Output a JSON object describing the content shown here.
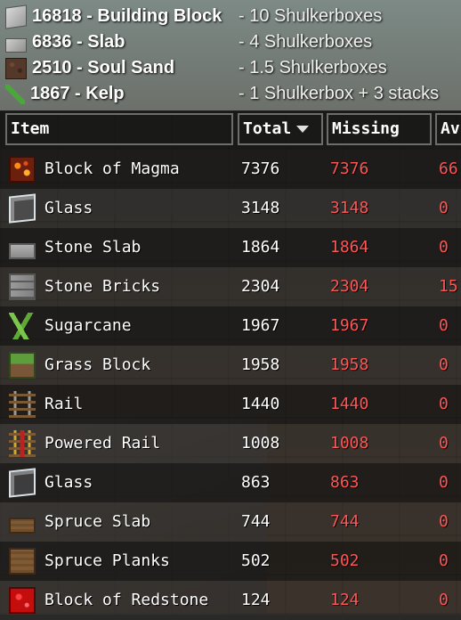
{
  "summary": [
    {
      "icon": "building-block-icon",
      "text": "16818 - Building Block",
      "note": "- 10 Shulkerboxes"
    },
    {
      "icon": "slab-icon",
      "text": "6836 - Slab",
      "note": "- 4 Shulkerboxes"
    },
    {
      "icon": "soul-sand-icon",
      "text": "2510 - Soul Sand",
      "note": "- 1.5 Shulkerboxes"
    },
    {
      "icon": "kelp-icon",
      "text": "1867 - Kelp",
      "note": "- 1 Shulkerbox + 3 stacks"
    }
  ],
  "table": {
    "headers": {
      "item": "Item",
      "total": "Total",
      "missing": "Missing",
      "available": "Av"
    },
    "rows": [
      {
        "icon": "magma-block-icon",
        "name": "Block of Magma",
        "total": "7376",
        "missing": "7376",
        "available": "66"
      },
      {
        "icon": "glass-icon",
        "name": "Glass",
        "total": "3148",
        "missing": "3148",
        "available": "0"
      },
      {
        "icon": "stone-slab-icon",
        "name": "Stone Slab",
        "total": "1864",
        "missing": "1864",
        "available": "0"
      },
      {
        "icon": "stone-bricks-icon",
        "name": "Stone Bricks",
        "total": "2304",
        "missing": "2304",
        "available": "15"
      },
      {
        "icon": "sugarcane-icon",
        "name": "Sugarcane",
        "total": "1967",
        "missing": "1967",
        "available": "0"
      },
      {
        "icon": "grass-block-icon",
        "name": "Grass Block",
        "total": "1958",
        "missing": "1958",
        "available": "0"
      },
      {
        "icon": "rail-icon",
        "name": "Rail",
        "total": "1440",
        "missing": "1440",
        "available": "0"
      },
      {
        "icon": "powered-rail-icon",
        "name": "Powered Rail",
        "total": "1008",
        "missing": "1008",
        "available": "0"
      },
      {
        "icon": "glass-icon",
        "name": "Glass",
        "total": "863",
        "missing": "863",
        "available": "0"
      },
      {
        "icon": "spruce-slab-icon",
        "name": "Spruce Slab",
        "total": "744",
        "missing": "744",
        "available": "0"
      },
      {
        "icon": "spruce-planks-icon",
        "name": "Spruce Planks",
        "total": "502",
        "missing": "502",
        "available": "0"
      },
      {
        "icon": "redstone-block-icon",
        "name": "Block of Redstone",
        "total": "124",
        "missing": "124",
        "available": "0"
      }
    ]
  },
  "colors": {
    "missing": "#ff5555",
    "header_border": "#6d6d6d",
    "text": "#ffffff"
  }
}
